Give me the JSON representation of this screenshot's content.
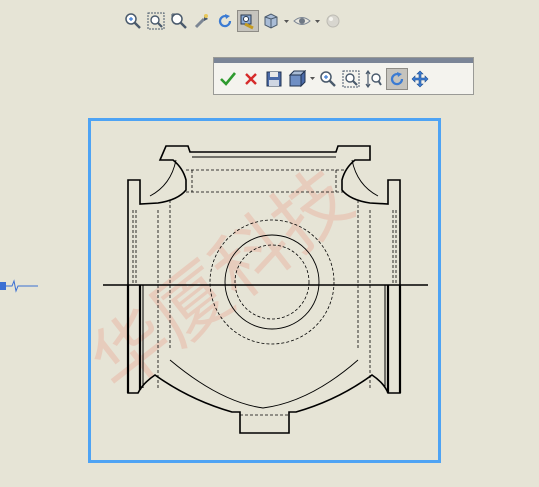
{
  "top_toolbar": {
    "buttons": [
      {
        "name": "zoom-to-fit-icon",
        "active": false
      },
      {
        "name": "zoom-to-area-icon",
        "active": false
      },
      {
        "name": "zoom-in-out-icon",
        "active": false
      },
      {
        "name": "pan-icon",
        "active": false
      },
      {
        "name": "rotate-view-icon",
        "active": false
      },
      {
        "name": "tools-icon",
        "active": true
      },
      {
        "name": "display-style-icon",
        "active": false
      },
      {
        "name": "hide-show-icon",
        "active": false
      },
      {
        "name": "appearance-icon",
        "active": false
      }
    ]
  },
  "floating_toolbar": {
    "buttons": [
      {
        "name": "ok-check-icon",
        "color": "#2e9a2e"
      },
      {
        "name": "cancel-x-icon",
        "color": "#d62b2b"
      },
      {
        "name": "save-view-icon"
      },
      {
        "name": "view-orientation-icon"
      },
      {
        "name": "zoom-to-fit-icon"
      },
      {
        "name": "zoom-to-area-icon"
      },
      {
        "name": "zoom-in-out-icon"
      },
      {
        "name": "rotate-view-icon",
        "active": true
      },
      {
        "name": "pan-icon"
      }
    ]
  },
  "watermark": {
    "text": "华厦科技",
    "color": "#e8b9a8"
  },
  "colors": {
    "background": "#e6e4d6",
    "selection_frame": "#4ea3f4",
    "drawing_line": "#000000"
  }
}
